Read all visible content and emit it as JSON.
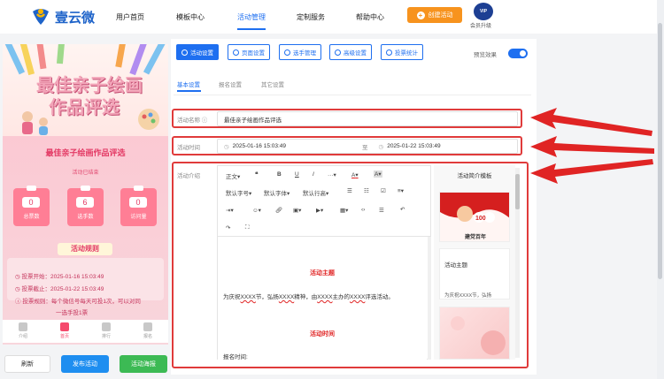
{
  "header": {
    "brand": "壹云微",
    "nav": [
      "用户首页",
      "模板中心",
      "活动管理",
      "定制服务",
      "帮助中心"
    ],
    "active_nav": "活动管理",
    "create_button": "创建活动",
    "vip_badge": "VIP",
    "vip_label": "会员升级"
  },
  "preview": {
    "poster_title_line1": "最佳亲子绘画",
    "poster_title_line2": "作品评选",
    "activity_name": "最佳亲子绘画作品评选",
    "status": "活动已结束",
    "stats": [
      {
        "value": "0",
        "label": "总票数"
      },
      {
        "value": "6",
        "label": "选手数"
      },
      {
        "value": "0",
        "label": "访问量"
      }
    ],
    "rules_title": "活动规则",
    "rules": [
      "投票开始：2025-01-16 15:03:49",
      "投票截止：2025-01-22 15:03:49",
      "投票规则：每个微信号每天可投1次，可以对同",
      "一选手投1票"
    ],
    "tabbar": [
      "介绍",
      "首页",
      "排行",
      "报名"
    ],
    "active_tab": "首页",
    "buttons": {
      "refresh": "刷新",
      "publish": "发布活动",
      "poster": "活动海报"
    }
  },
  "toolbar": {
    "buttons": [
      "活动设置",
      "页面设置",
      "选手管理",
      "高级设置",
      "投票统计"
    ],
    "active": "活动设置",
    "preview_label": "预览效果",
    "preview_on": true
  },
  "subtabs": [
    "基本设置",
    "报名设置",
    "其它设置"
  ],
  "form": {
    "name_label": "活动名称",
    "name_value": "最佳亲子绘画作品评选",
    "time_label": "活动时间",
    "start_time": "2025-01-16 15:03:49",
    "to": "至",
    "end_time": "2025-01-22 15:03:49",
    "intro_label": "活动介绍"
  },
  "editor": {
    "row1": [
      "正文",
      "❝",
      "B",
      "U",
      "I",
      "···",
      "A",
      "A"
    ],
    "row2": [
      "默认字号",
      "默认字体",
      "默认行高"
    ],
    "doc": {
      "heading1": "活动主题",
      "para1_prefix": "为庆祝",
      "para1_x1": "XXXX",
      "para1_mid1": "节，弘扬",
      "para1_x2": "XXXX",
      "para1_mid2": "精神，由",
      "para1_x3": "XXXX",
      "para1_mid3": "主办的",
      "para1_x4": "XXXX",
      "para1_suffix": "评选活动。",
      "heading2": "活动时间",
      "para2": "报名时间:"
    }
  },
  "template_panel": {
    "title": "活动简介模板",
    "card1_text": "建党百年",
    "card2_title": "活动主题",
    "card2_text": "为庆祝XXXX节，弘扬"
  },
  "colors": {
    "primary": "#1e6ff0",
    "accent": "#f7931e",
    "pink": "#e33964",
    "red": "#e02424"
  }
}
